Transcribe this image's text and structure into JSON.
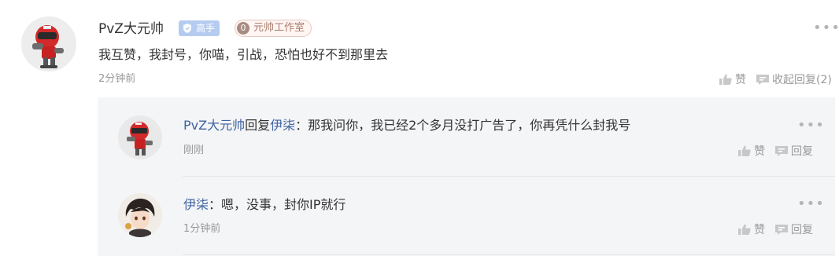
{
  "comment": {
    "username": "PvZ大元帅",
    "level_badge": "高手",
    "studio_badge_initial": "0",
    "studio_badge": "元帅工作室",
    "text": "我互赞，我封号，你喵，引战，恐怕也好不到那里去",
    "time": "2分钟前",
    "like_label": "赞",
    "collapse_reply_label": "收起回复(2)",
    "more_label": "•••"
  },
  "replies": [
    {
      "author": "PvZ大元帅",
      "reply_word": "回复",
      "target": "伊柒",
      "text": "：那我问你，我已经2个多月没打广告了，你再凭什么封我号",
      "time": "刚刚",
      "like_label": "赞",
      "reply_label": "回复",
      "more_label": "•••"
    },
    {
      "author": "伊柒",
      "text": "：嗯，没事，封你IP就行",
      "time": "1分钟前",
      "like_label": "赞",
      "reply_label": "回复",
      "more_label": "•••"
    }
  ],
  "colors": {
    "link": "#3f63a0",
    "level_badge_bg": "#b5ccf0",
    "studio_badge_text": "#a97c6d",
    "reply_panel_bg": "#f4f5f7"
  },
  "icons": {
    "like": "thumbs-up-icon",
    "reply": "speech-bubble-icon",
    "more": "more-dots-icon",
    "level": "shield-icon"
  }
}
